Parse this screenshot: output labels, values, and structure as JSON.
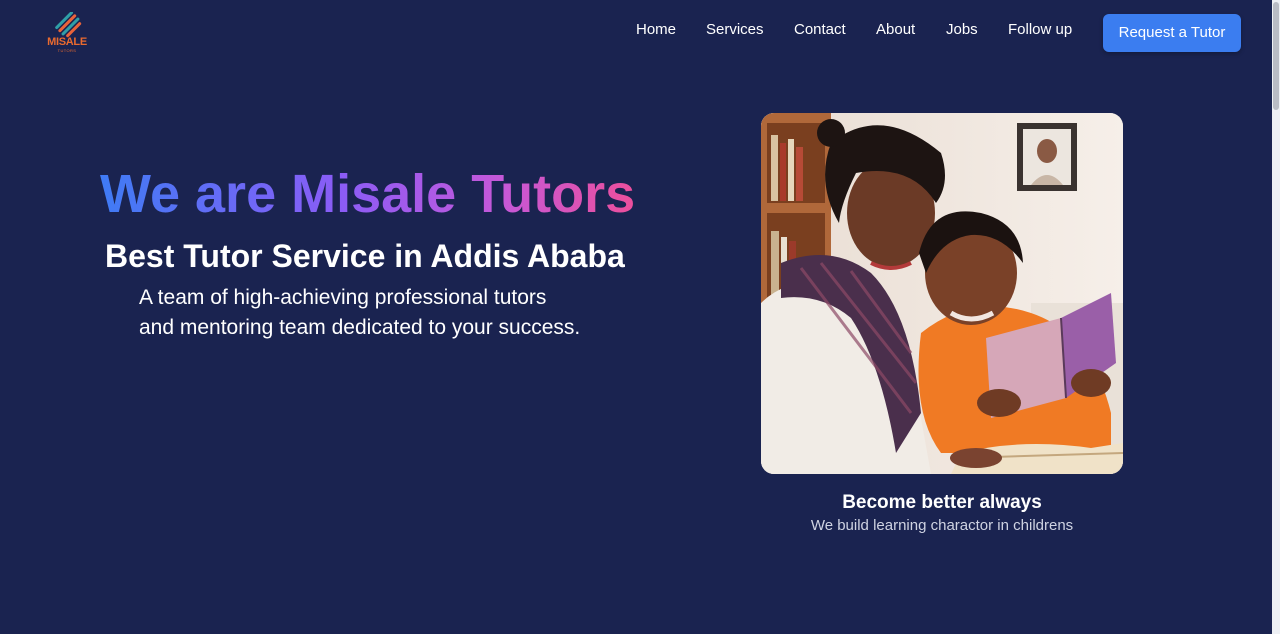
{
  "brand": {
    "name": "MISALE",
    "tagline": "TUTORS"
  },
  "nav": {
    "items": [
      {
        "label": "Home"
      },
      {
        "label": "Services"
      },
      {
        "label": "Contact"
      },
      {
        "label": "About"
      },
      {
        "label": "Jobs"
      },
      {
        "label": "Follow up"
      }
    ],
    "cta_label": "Request a Tutor"
  },
  "hero": {
    "title": "We are Misale Tutors",
    "subtitle": "Best Tutor Service in Addis Ababa",
    "description_lines": [
      "A team of high-achieving professional tutors",
      "and mentoring team dedicated to your success."
    ]
  },
  "feature": {
    "caption_title": "Become better always",
    "caption_subtitle": "We build learning charactor in childrens"
  },
  "colors": {
    "background": "#1a2350",
    "accent": "#3b7df0",
    "brand_orange": "#e96a2f",
    "gradient_start": "#3f7bf5",
    "gradient_end": "#ec4f9c"
  }
}
